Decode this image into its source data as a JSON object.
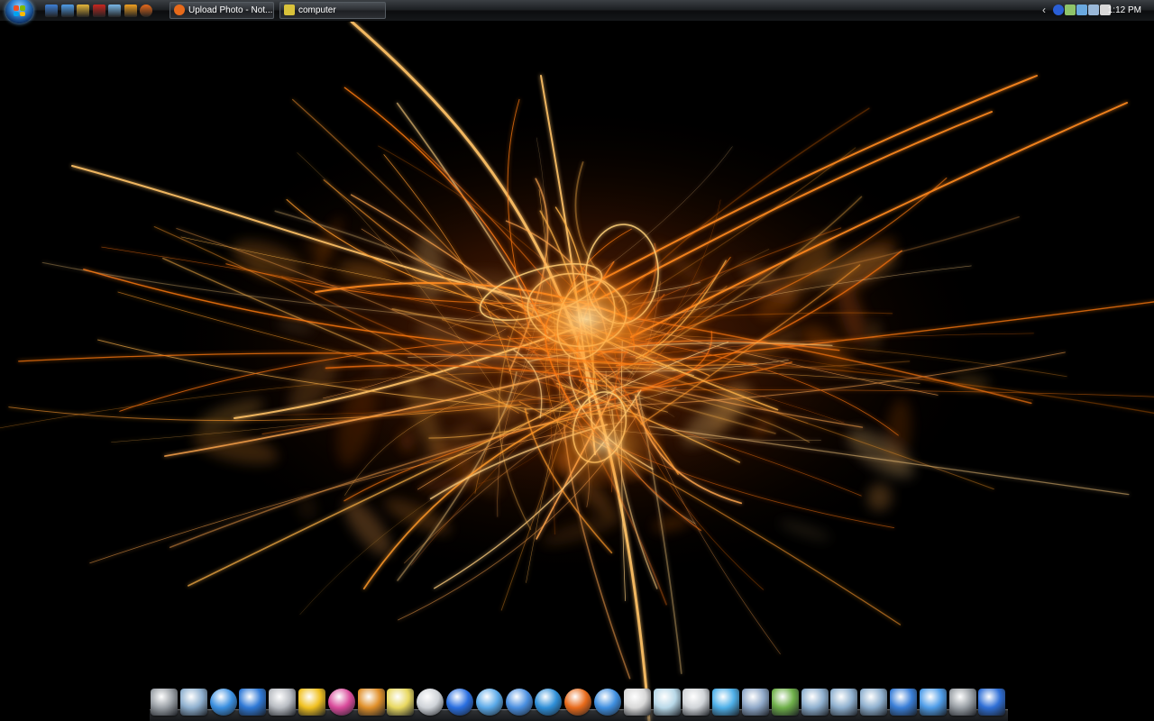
{
  "taskbar": {
    "start_button": "start-orb",
    "quick_launch": [
      {
        "name": "show-desktop-icon",
        "color": "#3d7fd6"
      },
      {
        "name": "switch-windows-icon",
        "color": "#4f9de8"
      },
      {
        "name": "folder-icon",
        "color": "#e5b63a"
      },
      {
        "name": "flash-icon",
        "color": "#c8261f"
      },
      {
        "name": "messenger-icon",
        "color": "#7ab8e8"
      },
      {
        "name": "media-player-icon",
        "color": "#f0a020"
      },
      {
        "name": "firefox-icon",
        "color": "#e86a1a"
      }
    ],
    "window_buttons": [
      {
        "label": "Upload Photo - Not...",
        "icon": "firefox-icon",
        "color": "#e86a1a"
      },
      {
        "label": "computer",
        "icon": "folder-icon",
        "color": "#d9c23a"
      }
    ],
    "tray": {
      "expand_glyph": "‹",
      "icons": [
        {
          "name": "network-globe-icon",
          "color": "#2a5fd6"
        },
        {
          "name": "safely-remove-icon",
          "color": "#8fc46a"
        },
        {
          "name": "network-icon",
          "color": "#6aa9e0"
        },
        {
          "name": "display-icon",
          "color": "#9ab8d8"
        },
        {
          "name": "volume-icon",
          "color": "#d8d8d8"
        }
      ],
      "clock": "1:12 PM"
    }
  },
  "desktop": {
    "wallpaper": "orange-fractal-streaks",
    "colors": {
      "background": "#000000",
      "glow": "#ff8a1e",
      "core": "#ffd27a"
    }
  },
  "dock": {
    "items": [
      {
        "name": "trash-icon",
        "color": "#9aa0a6"
      },
      {
        "name": "utilities-folder-icon",
        "color": "#8fb0cf"
      },
      {
        "name": "globe-icon",
        "color": "#3a8fe0"
      },
      {
        "name": "windows-icon",
        "color": "#2f79d6"
      },
      {
        "name": "app-store-icon",
        "color": "#b8bcc2"
      },
      {
        "name": "linux-tux-icon",
        "color": "#f0c020"
      },
      {
        "name": "colorful-ball-icon",
        "color": "#d94a9a"
      },
      {
        "name": "mail-icon",
        "color": "#e0902a"
      },
      {
        "name": "notes-paint-icon",
        "color": "#e8d860"
      },
      {
        "name": "webcam-icon",
        "color": "#cfd3d8"
      },
      {
        "name": "media-play-icon",
        "color": "#2a6fe0"
      },
      {
        "name": "itunes-icon",
        "color": "#5aa9e8"
      },
      {
        "name": "quicktime-icon",
        "color": "#4a8fe0"
      },
      {
        "name": "network-globe-icon",
        "color": "#2f8fd8"
      },
      {
        "name": "firefox-icon",
        "color": "#e86a1a"
      },
      {
        "name": "internet-explorer-icon",
        "color": "#3f8fe0"
      },
      {
        "name": "7zip-icon",
        "color": "#d8d8d8"
      },
      {
        "name": "notepad-icon",
        "color": "#b8d8e8"
      },
      {
        "name": "stamp-icon",
        "color": "#d0d4d8"
      },
      {
        "name": "word-processor-icon",
        "color": "#4fb0e8"
      },
      {
        "name": "laptop-icon",
        "color": "#8fa8c8"
      },
      {
        "name": "downloads-icon",
        "color": "#6fb04a"
      },
      {
        "name": "library-folder-icon",
        "color": "#8fb0cf"
      },
      {
        "name": "music-folder-icon",
        "color": "#8fb0cf"
      },
      {
        "name": "pictures-folder-icon",
        "color": "#8fb0cf"
      },
      {
        "name": "finder-icon",
        "color": "#3a7fd8"
      },
      {
        "name": "screens-icon",
        "color": "#4f9de8"
      },
      {
        "name": "system-preferences-icon",
        "color": "#9aa0a6"
      },
      {
        "name": "app-store-blue-icon",
        "color": "#2f6fd6"
      }
    ]
  }
}
